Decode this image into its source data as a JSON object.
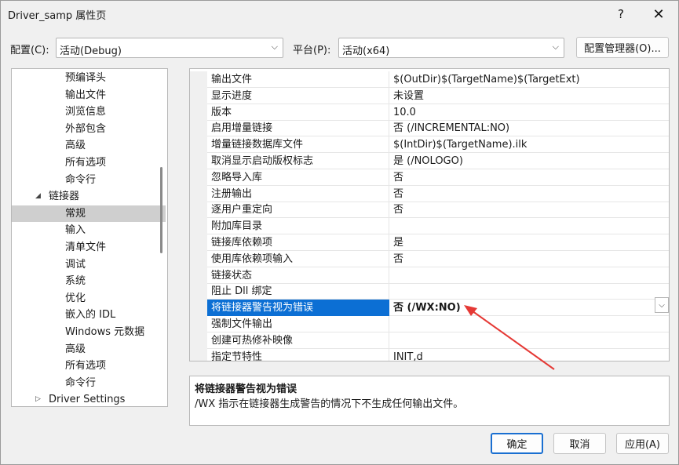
{
  "window": {
    "title": "Driver_samp 属性页",
    "help_glyph": "?",
    "close_glyph": "✕"
  },
  "toolbar": {
    "config_label": "配置(C):",
    "config_value": "活动(Debug)",
    "platform_label": "平台(P):",
    "platform_value": "活动(x64)",
    "config_manager_label": "配置管理器(O)..."
  },
  "tree": {
    "items": [
      {
        "label": "预编译头",
        "level": 2
      },
      {
        "label": "输出文件",
        "level": 2
      },
      {
        "label": "浏览信息",
        "level": 2
      },
      {
        "label": "外部包含",
        "level": 2
      },
      {
        "label": "高级",
        "level": 2
      },
      {
        "label": "所有选项",
        "level": 2
      },
      {
        "label": "命令行",
        "level": 2
      },
      {
        "label": "链接器",
        "level": 1,
        "expanded": true
      },
      {
        "label": "常规",
        "level": 2,
        "selected": true
      },
      {
        "label": "输入",
        "level": 2
      },
      {
        "label": "清单文件",
        "level": 2
      },
      {
        "label": "调试",
        "level": 2
      },
      {
        "label": "系统",
        "level": 2
      },
      {
        "label": "优化",
        "level": 2
      },
      {
        "label": "嵌入的 IDL",
        "level": 2
      },
      {
        "label": "Windows 元数据",
        "level": 2
      },
      {
        "label": "高级",
        "level": 2
      },
      {
        "label": "所有选项",
        "level": 2
      },
      {
        "label": "命令行",
        "level": 2
      },
      {
        "label": "Driver Settings",
        "level": 1,
        "expanded": false
      }
    ],
    "expanded_glyph": "◢",
    "collapsed_glyph": "▷"
  },
  "grid": {
    "rows": [
      {
        "name": "输出文件",
        "value": "$(OutDir)$(TargetName)$(TargetExt)"
      },
      {
        "name": "显示进度",
        "value": "未设置"
      },
      {
        "name": "版本",
        "value": "10.0"
      },
      {
        "name": "启用增量链接",
        "value": "否 (/INCREMENTAL:NO)"
      },
      {
        "name": "增量链接数据库文件",
        "value": "$(IntDir)$(TargetName).ilk"
      },
      {
        "name": "取消显示启动版权标志",
        "value": "是 (/NOLOGO)"
      },
      {
        "name": "忽略导入库",
        "value": "否"
      },
      {
        "name": "注册输出",
        "value": "否"
      },
      {
        "name": "逐用户重定向",
        "value": "否"
      },
      {
        "name": "附加库目录",
        "value": ""
      },
      {
        "name": "链接库依赖项",
        "value": "是"
      },
      {
        "name": "使用库依赖项输入",
        "value": "否"
      },
      {
        "name": "链接状态",
        "value": ""
      },
      {
        "name": "阻止 Dll 绑定",
        "value": ""
      },
      {
        "name": "将链接器警告视为错误",
        "value": "否 (/WX:NO)",
        "selected": true
      },
      {
        "name": "强制文件输出",
        "value": ""
      },
      {
        "name": "创建可热修补映像",
        "value": ""
      },
      {
        "name": "指定节特性",
        "value": "INIT,d"
      }
    ],
    "dropdown_glyph": "⌵"
  },
  "description": {
    "title": "将链接器警告视为错误",
    "text": "/WX 指示在链接器生成警告的情况下不生成任何输出文件。"
  },
  "buttons": {
    "ok": "确定",
    "cancel": "取消",
    "apply": "应用(A)"
  },
  "colors": {
    "selection": "#0c6fd4",
    "annotation_arrow": "#e53935"
  }
}
